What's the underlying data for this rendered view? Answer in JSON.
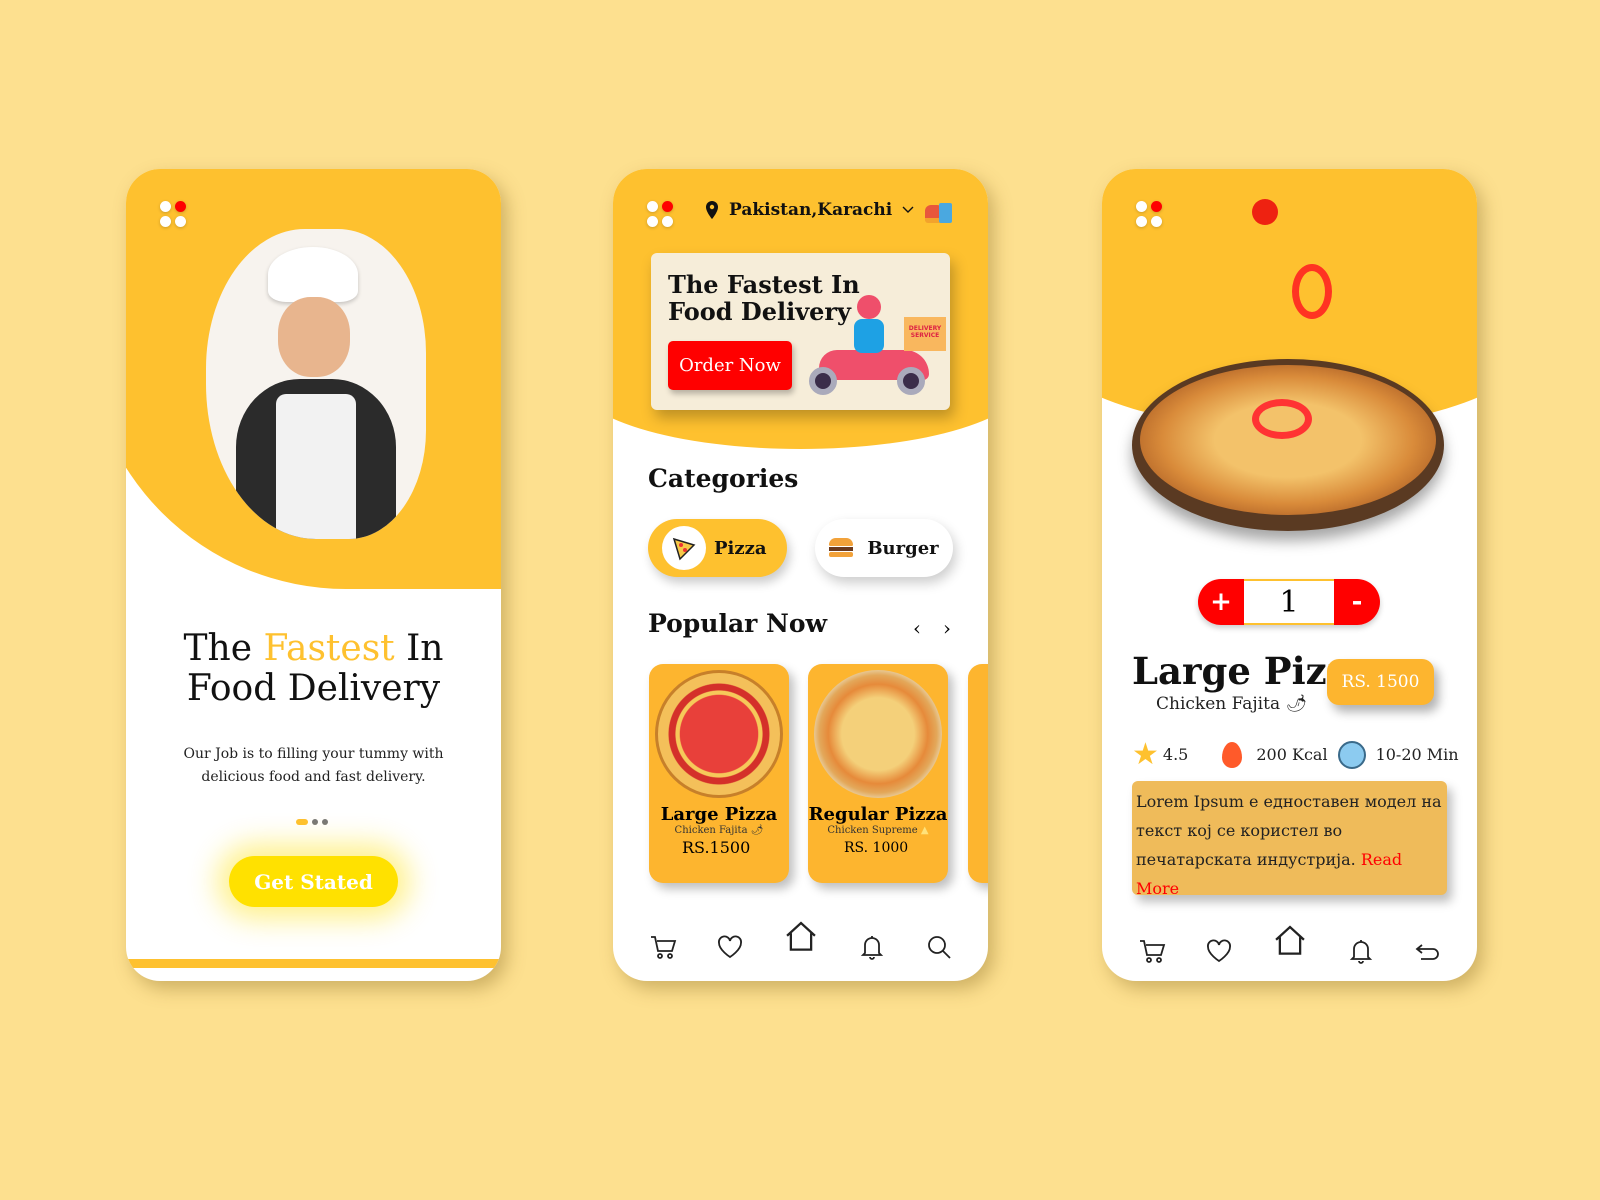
{
  "colors": {
    "background": "#fde08f",
    "primary_yellow": "#fec12f",
    "accent_red": "#ff0000",
    "button_yellow": "#ffe100"
  },
  "screen1": {
    "title_part1": "The ",
    "title_highlight": "Fastest",
    "title_part2": " In",
    "title_line2": "Food Delivery",
    "description_line1": "Our Job is to filling your tummy with",
    "description_line2": "delicious food and fast delivery.",
    "cta_label": "Get Stated",
    "page_indicator": {
      "count": 3,
      "active": 1
    }
  },
  "screen2": {
    "location": "Pakistan,Karachi",
    "banner": {
      "title_line1": "The Fastest In",
      "title_line2": "Food Delivery",
      "button_label": "Order Now",
      "box_text": "DELIVERY SERVICE"
    },
    "categories_title": "Categories",
    "categories": [
      {
        "label": "Pizza",
        "icon": "pizza-slice-icon",
        "active": true
      },
      {
        "label": "Burger",
        "icon": "burger-icon",
        "active": false
      }
    ],
    "popular_title": "Popular Now",
    "popular": [
      {
        "name": "Large Pizza",
        "subtitle": "Chicken Fajita",
        "price": "RS.1500",
        "icon": "chili-icon"
      },
      {
        "name": "Regular Pizza",
        "subtitle": "Chicken Supreme",
        "price": "RS. 1000",
        "icon": "cheese-icon"
      }
    ],
    "nav": [
      "cart-icon",
      "heart-icon",
      "home-icon",
      "bell-icon",
      "search-icon"
    ]
  },
  "screen3": {
    "quantity": "1",
    "plus_label": "+",
    "minus_label": "-",
    "title": "Large Pizza",
    "subtitle": "Chicken Fajita",
    "price": "RS. 1500",
    "rating": "4.5",
    "calories": "200 Kcal",
    "time": "10-20 Min",
    "description": "Lorem Ipsum е едноставен модел на текст кој се користел во печатарската индустрија. ",
    "read_more": "Read More",
    "nav": [
      "cart-icon",
      "heart-icon",
      "home-icon",
      "bell-icon",
      "back-icon"
    ]
  }
}
